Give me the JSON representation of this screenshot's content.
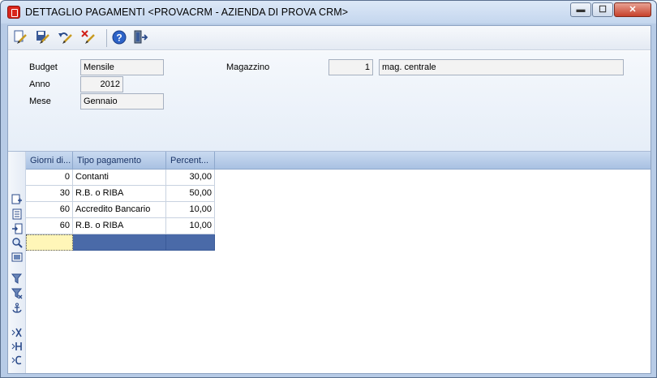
{
  "window": {
    "title": "DETTAGLIO PAGAMENTI <PROVACRM - AZIENDA DI PROVA CRM>",
    "min_glyph": "▬",
    "max_glyph": "☐",
    "close_glyph": "✕"
  },
  "toolbar": {
    "icons": [
      "new-doc-icon",
      "save-icon",
      "undo-icon",
      "delete-icon",
      "help-icon",
      "exit-icon"
    ]
  },
  "header": {
    "budget_label": "Budget",
    "budget_value": "Mensile",
    "anno_label": "Anno",
    "anno_value": "2012",
    "mese_label": "Mese",
    "mese_value": "Gennaio",
    "magazzino_label": "Magazzino",
    "magazzino_code": "1",
    "magazzino_name": "mag. centrale"
  },
  "grid": {
    "columns": [
      "Giorni di...",
      "Tipo pagamento",
      "Percent..."
    ],
    "rows": [
      {
        "giorni": "0",
        "tipo": "Contanti",
        "percent": "30,00"
      },
      {
        "giorni": "30",
        "tipo": "R.B. o RIBA",
        "percent": "50,00"
      },
      {
        "giorni": "60",
        "tipo": "Accredito Bancario",
        "percent": "10,00"
      },
      {
        "giorni": "60",
        "tipo": "R.B. o RIBA",
        "percent": "10,00"
      }
    ]
  },
  "side_tools": [
    "insert-row-icon",
    "list-icon",
    "import-icon",
    "search-icon",
    "preview-icon",
    "filter-icon",
    "filter-remove-icon",
    "anchor-icon",
    "export-excel-icon",
    "export-html-icon",
    "export-csv-icon"
  ],
  "colors": {
    "grid_header": "#b9cde9",
    "selected_row": "#4a6aa8",
    "edit_cell": "#fff6b8"
  }
}
